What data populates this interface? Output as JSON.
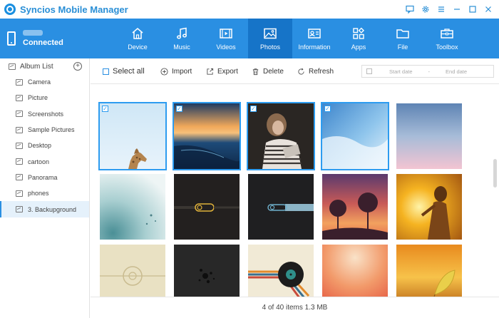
{
  "app": {
    "title": "Syncios Mobile Manager"
  },
  "device": {
    "status": "Connected"
  },
  "nav": [
    {
      "label": "Device",
      "icon": "home-icon"
    },
    {
      "label": "Music",
      "icon": "music-note-icon"
    },
    {
      "label": "Videos",
      "icon": "film-icon"
    },
    {
      "label": "Photos",
      "icon": "image-icon",
      "active": true
    },
    {
      "label": "Information",
      "icon": "contact-card-icon"
    },
    {
      "label": "Apps",
      "icon": "apps-grid-icon"
    },
    {
      "label": "File",
      "icon": "folder-icon"
    },
    {
      "label": "Toolbox",
      "icon": "toolbox-icon"
    }
  ],
  "sidebar": {
    "header": "Album List",
    "items": [
      {
        "label": "Camera"
      },
      {
        "label": "Picture"
      },
      {
        "label": "Screenshots"
      },
      {
        "label": "Sample Pictures"
      },
      {
        "label": "Desktop"
      },
      {
        "label": "cartoon"
      },
      {
        "label": "Panorama"
      },
      {
        "label": "phones"
      },
      {
        "label": "3. Backupground",
        "active": true
      }
    ]
  },
  "toolbar": {
    "select_all": "Select all",
    "import": "Import",
    "export": "Export",
    "delete": "Delete",
    "refresh": "Refresh",
    "start_date": "Start date",
    "date_sep": "-",
    "end_date": "End date"
  },
  "photos": [
    {
      "name": "giraffe",
      "selected": true
    },
    {
      "name": "sunset-ocean",
      "selected": true
    },
    {
      "name": "girl-reading",
      "selected": true
    },
    {
      "name": "blue-watercolor",
      "selected": true
    },
    {
      "name": "pink-blue-gradient",
      "selected": false
    },
    {
      "name": "teal-watercolor",
      "selected": false
    },
    {
      "name": "dark-cable-yellow",
      "selected": false
    },
    {
      "name": "dark-cable-blue",
      "selected": false
    },
    {
      "name": "sunset-trees",
      "selected": false
    },
    {
      "name": "sunset-woman",
      "selected": false
    },
    {
      "name": "beige-circle",
      "selected": false
    },
    {
      "name": "dark-dots",
      "selected": false
    },
    {
      "name": "vinyl-record",
      "selected": false
    },
    {
      "name": "orange-watercolor",
      "selected": false
    },
    {
      "name": "golden-leaf",
      "selected": false
    }
  ],
  "status": {
    "text": "4 of 40 items 1.3 MB"
  },
  "colors": {
    "accent": "#2a8fe2",
    "nav_active": "#1674c8",
    "selection": "#2d9cf0"
  }
}
